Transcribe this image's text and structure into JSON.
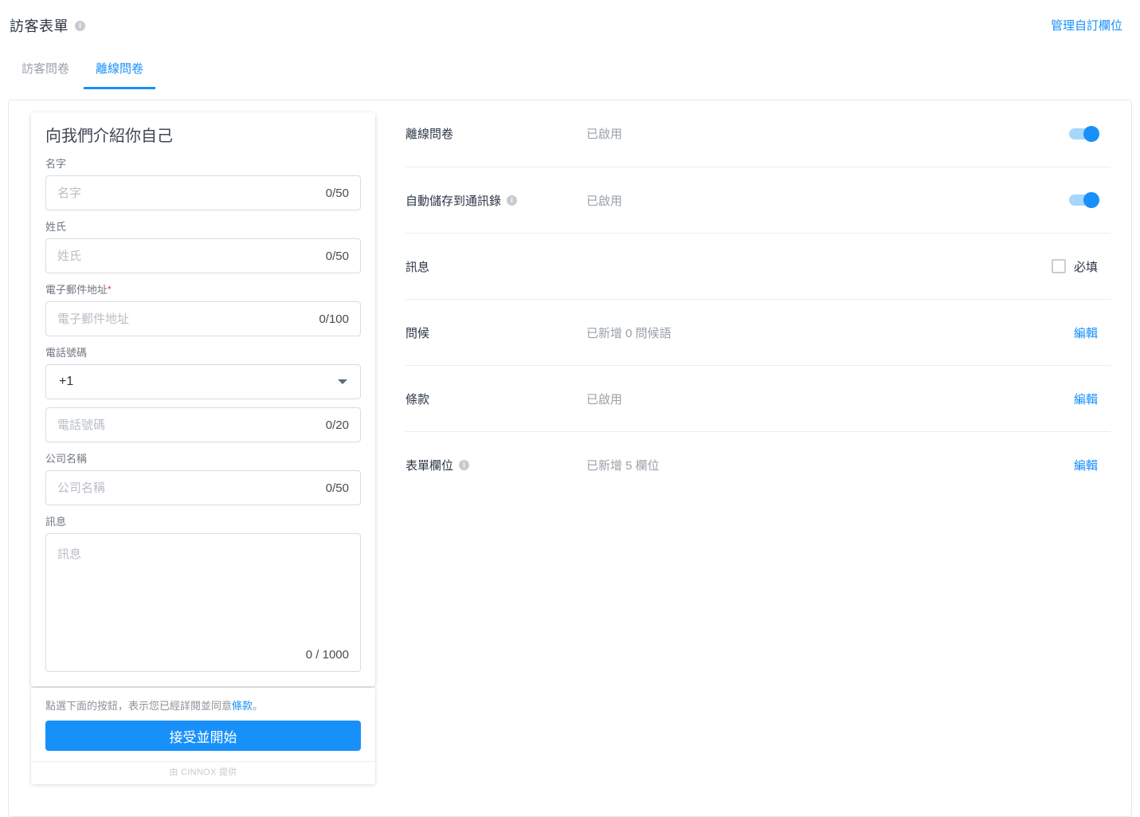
{
  "header": {
    "title": "訪客表單",
    "manage_link": "管理自訂欄位"
  },
  "tabs": [
    {
      "label": "訪客問卷",
      "active": false
    },
    {
      "label": "離線問卷",
      "active": true
    }
  ],
  "preview": {
    "title": "向我們介紹你自己",
    "first_name": {
      "label": "名字",
      "placeholder": "名字",
      "counter": "0/50"
    },
    "last_name": {
      "label": "姓氏",
      "placeholder": "姓氏",
      "counter": "0/50"
    },
    "email": {
      "label": "電子郵件地址",
      "required_mark": "*",
      "placeholder": "電子郵件地址",
      "counter": "0/100"
    },
    "phone": {
      "label": "電話號碼",
      "country_code": "+1",
      "placeholder": "電話號碼",
      "counter": "0/20"
    },
    "company": {
      "label": "公司名稱",
      "placeholder": "公司名稱",
      "counter": "0/50"
    },
    "message": {
      "label": "訊息",
      "placeholder": "訊息",
      "counter": "0 / 1000"
    },
    "agreement": {
      "prefix": "點選下面的按鈕，表示您已經詳閱並同意",
      "link": "條款",
      "suffix": "。"
    },
    "accept_button": "接受並開始",
    "powered_by": "由 CINNOX 提供"
  },
  "settings": {
    "rows": [
      {
        "label": "離線問卷",
        "status": "已啟用",
        "control": "toggle",
        "state": "on"
      },
      {
        "label": "自動儲存到通訊錄",
        "has_info_icon": true,
        "status": "已啟用",
        "control": "toggle",
        "state": "on"
      },
      {
        "label": "訊息",
        "status": "",
        "control": "checkbox",
        "state": "unchecked",
        "checkbox_label": "必填"
      },
      {
        "label": "問候",
        "status": "已新增 0 問候語",
        "control": "link",
        "action": "編輯"
      },
      {
        "label": "條款",
        "status": "已啟用",
        "control": "link",
        "action": "編輯"
      },
      {
        "label": "表單欄位",
        "has_info_icon": true,
        "status": "已新增 5 欄位",
        "control": "link",
        "action": "編輯"
      }
    ]
  },
  "colors": {
    "accent_blue": "#1790fa",
    "toggle_track_blue": "#a5d6fb",
    "required_red": "#e53935",
    "text_dark": "#2b3644",
    "text_muted": "#9aa1a9",
    "divider": "#ebedf0"
  }
}
